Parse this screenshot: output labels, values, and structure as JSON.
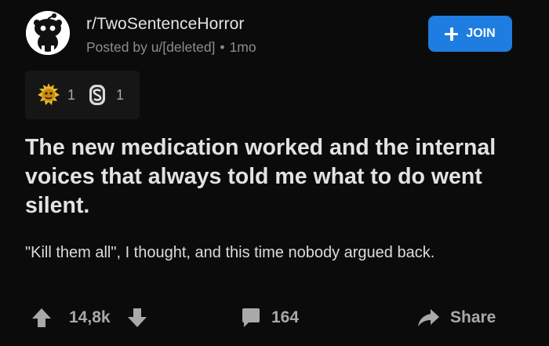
{
  "header": {
    "subreddit": "r/TwoSentenceHorror",
    "posted_by": "Posted by u/[deleted]",
    "separator": "•",
    "age": "1mo",
    "join_label": "JOIN"
  },
  "awards": [
    {
      "icon": "gold-award-icon",
      "count": "1"
    },
    {
      "icon": "silver-award-icon",
      "count": "1"
    }
  ],
  "post": {
    "title": "The new medication worked and the internal voices that always told me what to do went silent.",
    "body": "\"Kill them all\", I thought, and this time nobody argued back."
  },
  "actions": {
    "votes": "14,8k",
    "comments": "164",
    "share_label": "Share"
  },
  "colors": {
    "background": "#0b0b0b",
    "join_button": "#1f7ce0",
    "muted_text": "#8d8d8d",
    "action_gray": "#a9a9a9"
  }
}
